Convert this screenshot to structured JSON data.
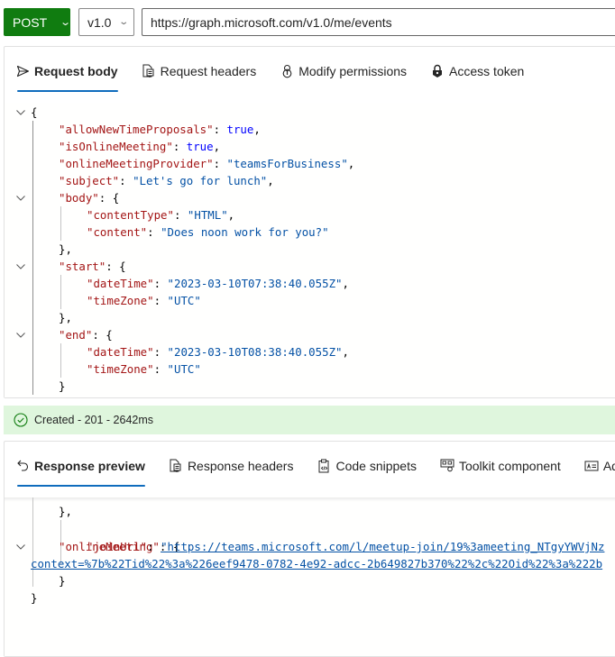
{
  "query": {
    "method": "POST",
    "version": "v1.0",
    "url": "https://graph.microsoft.com/v1.0/me/events"
  },
  "request_tabs": [
    {
      "label": "Request body",
      "icon": "send-icon",
      "active": true
    },
    {
      "label": "Request headers",
      "icon": "document-icon",
      "active": false
    },
    {
      "label": "Modify permissions",
      "icon": "key-icon",
      "active": false
    },
    {
      "label": "Access token",
      "icon": "lock-icon",
      "active": false
    }
  ],
  "request_body": {
    "lines": [
      {
        "open": "{"
      },
      {
        "key": "\"allowNewTimeProposals\"",
        "sep": ": ",
        "val": "true",
        "vtype": "b",
        "end": ","
      },
      {
        "key": "\"isOnlineMeeting\"",
        "sep": ": ",
        "val": "true",
        "vtype": "b",
        "end": ","
      },
      {
        "key": "\"onlineMeetingProvider\"",
        "sep": ": ",
        "val": "\"teamsForBusiness\"",
        "vtype": "s",
        "end": ","
      },
      {
        "key": "\"subject\"",
        "sep": ": ",
        "val": "\"Let's go for lunch\"",
        "vtype": "s",
        "end": ","
      },
      {
        "key": "\"body\"",
        "sep": ": ",
        "val": "{",
        "vtype": "p",
        "end": ""
      },
      {
        "key": "\"contentType\"",
        "sep": ": ",
        "val": "\"HTML\"",
        "vtype": "s",
        "end": ","
      },
      {
        "key": "\"content\"",
        "sep": ": ",
        "val": "\"Does noon work for you?\"",
        "vtype": "s",
        "end": ""
      },
      {
        "close": "},"
      },
      {
        "key": "\"start\"",
        "sep": ": ",
        "val": "{",
        "vtype": "p",
        "end": ""
      },
      {
        "key": "\"dateTime\"",
        "sep": ": ",
        "val": "\"2023-03-10T07:38:40.055Z\"",
        "vtype": "s",
        "end": ","
      },
      {
        "key": "\"timeZone\"",
        "sep": ": ",
        "val": "\"UTC\"",
        "vtype": "s",
        "end": ""
      },
      {
        "close": "},"
      },
      {
        "key": "\"end\"",
        "sep": ": ",
        "val": "{",
        "vtype": "p",
        "end": ""
      },
      {
        "key": "\"dateTime\"",
        "sep": ": ",
        "val": "\"2023-03-10T08:38:40.055Z\"",
        "vtype": "s",
        "end": ","
      },
      {
        "key": "\"timeZone\"",
        "sep": ": ",
        "val": "\"UTC\"",
        "vtype": "s",
        "end": ""
      },
      {
        "close": "}"
      }
    ]
  },
  "status": {
    "text": "Created - 201 - 2642ms",
    "icon": "check-circle-icon",
    "color": "#107c10"
  },
  "response_tabs": [
    {
      "label": "Response preview",
      "icon": "undo-arrow-icon",
      "active": true
    },
    {
      "label": "Response headers",
      "icon": "document-icon",
      "active": false
    },
    {
      "label": "Code snippets",
      "icon": "clipboard-code-icon",
      "active": false
    },
    {
      "label": "Toolkit component",
      "icon": "toolkit-icon",
      "active": false
    },
    {
      "label": "Adaptive cards",
      "icon": "card-icon",
      "active": false
    }
  ],
  "response_preview": {
    "partial_top": "},",
    "online_meeting_key": "\"onlineMeeting\"",
    "join_url_key": "\"joinUrl\"",
    "join_url_line1": "\"https://teams.microsoft.com/l/meetup-join/19%3ameeting_NTgyYWVjNz",
    "join_url_line2": "context=%7b%22Tid%22%3a%226eef9478-0782-4e92-adcc-2b649827b370%22%2c%22Oid%22%3a%222b",
    "close_inner": "}",
    "close_outer": "}"
  },
  "colors": {
    "method_bg": "#107c10",
    "tab_underline": "#0f6cbd",
    "status_bg": "#dff6dd",
    "json_key": "#a31515",
    "json_string": "#0451a5",
    "json_bool": "#0000ff"
  }
}
